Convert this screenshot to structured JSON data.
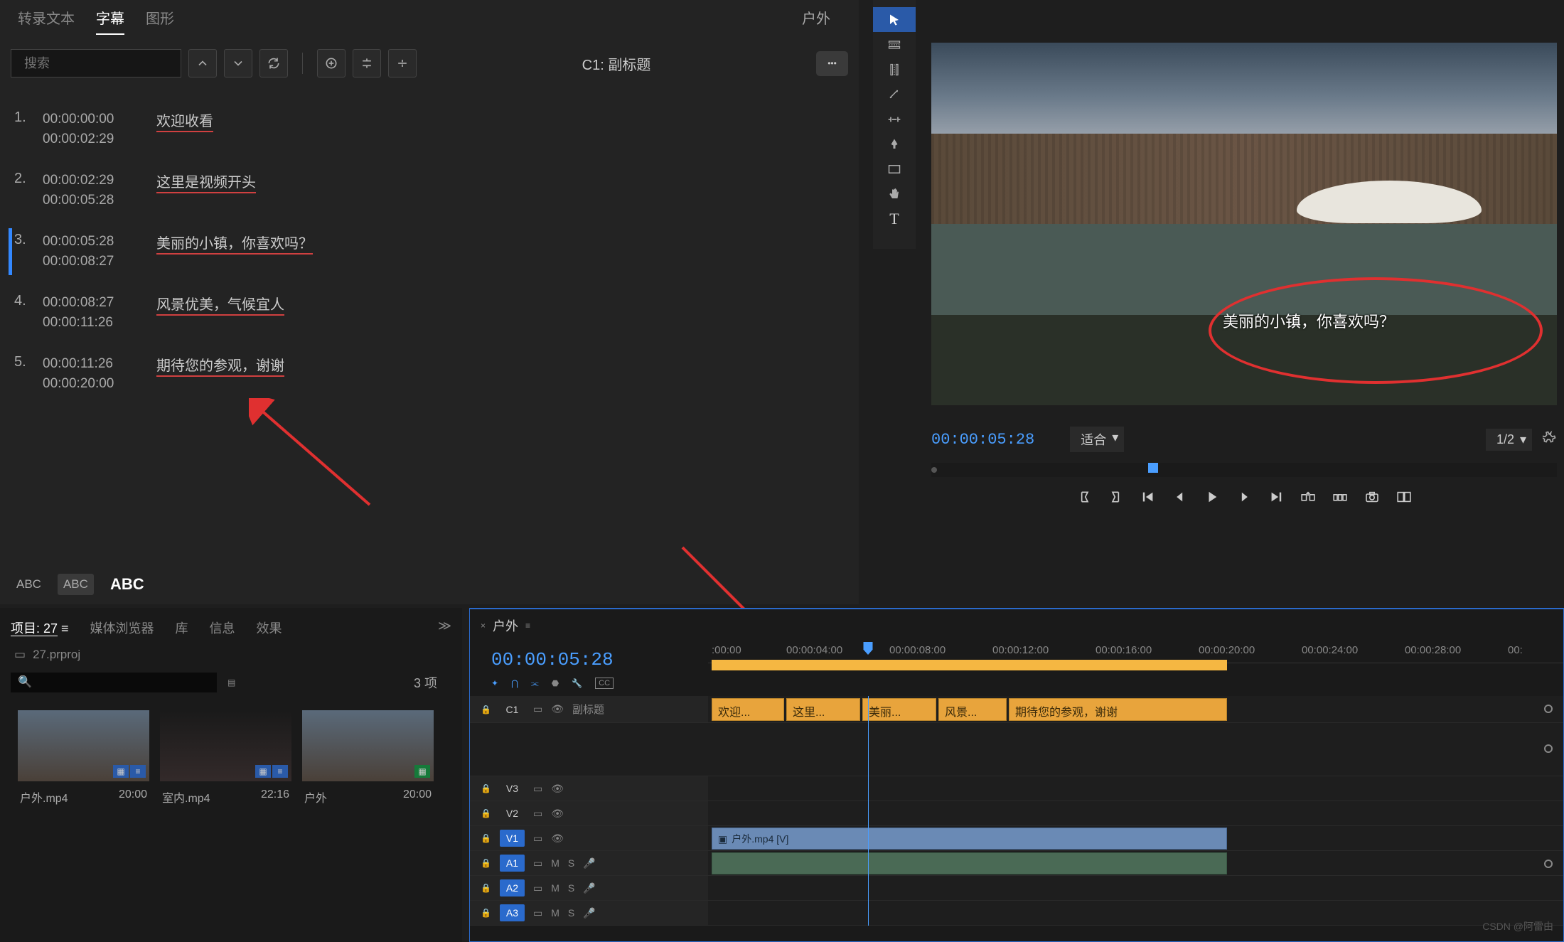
{
  "subtitlePanel": {
    "tabs": [
      "转录文本",
      "字幕",
      "图形"
    ],
    "activeTab": 1,
    "rightLabel": "户外",
    "searchPlaceholder": "搜索",
    "trackLabel": "C1: 副标题",
    "abcLabels": [
      "ABC",
      "ABC",
      "ABC"
    ],
    "items": [
      {
        "num": "1.",
        "in": "00:00:00:00",
        "out": "00:00:02:29",
        "text": "欢迎收看"
      },
      {
        "num": "2.",
        "in": "00:00:02:29",
        "out": "00:00:05:28",
        "text": "这里是视频开头"
      },
      {
        "num": "3.",
        "in": "00:00:05:28",
        "out": "00:00:08:27",
        "text": "美丽的小镇，你喜欢吗？"
      },
      {
        "num": "4.",
        "in": "00:00:08:27",
        "out": "00:00:11:26",
        "text": "风景优美，气候宜人"
      },
      {
        "num": "5.",
        "in": "00:00:11:26",
        "out": "00:00:20:00",
        "text": "期待您的参观，谢谢"
      }
    ],
    "activeIndex": 2
  },
  "program": {
    "overlaySubtitle": "美丽的小镇，你喜欢吗？",
    "timecode": "00:00:05:28",
    "fit": "适合",
    "scale": "1/2"
  },
  "project": {
    "tabs": [
      "项目: 27",
      "媒体浏览器",
      "库",
      "信息",
      "效果"
    ],
    "activeTab": 0,
    "filename": "27.prproj",
    "count": "3 项",
    "thumbs": [
      {
        "name": "户外.mp4",
        "dur": "20:00"
      },
      {
        "name": "室内.mp4",
        "dur": "22:16"
      },
      {
        "name": "户外",
        "dur": "20:00"
      }
    ]
  },
  "timeline": {
    "title": "户外",
    "timecode": "00:00:05:28",
    "subtitleTrack": {
      "label": "C1",
      "name": "副标题"
    },
    "ruler": [
      ":00:00",
      "00:00:04:00",
      "00:00:08:00",
      "00:00:12:00",
      "00:00:16:00",
      "00:00:20:00",
      "00:00:24:00",
      "00:00:28:00",
      "00:"
    ],
    "subClips": [
      "欢迎...",
      "这里...",
      "美丽...",
      "风景...",
      "期待您的参观，谢谢"
    ],
    "videoClip": "户外.mp4 [V]",
    "tracks": {
      "v3": "V3",
      "v2": "V2",
      "v1": "V1",
      "a1": "A1",
      "a2": "A2",
      "a3": "A3",
      "m": "M",
      "s": "S"
    }
  },
  "watermark": "CSDN @阿雷由"
}
